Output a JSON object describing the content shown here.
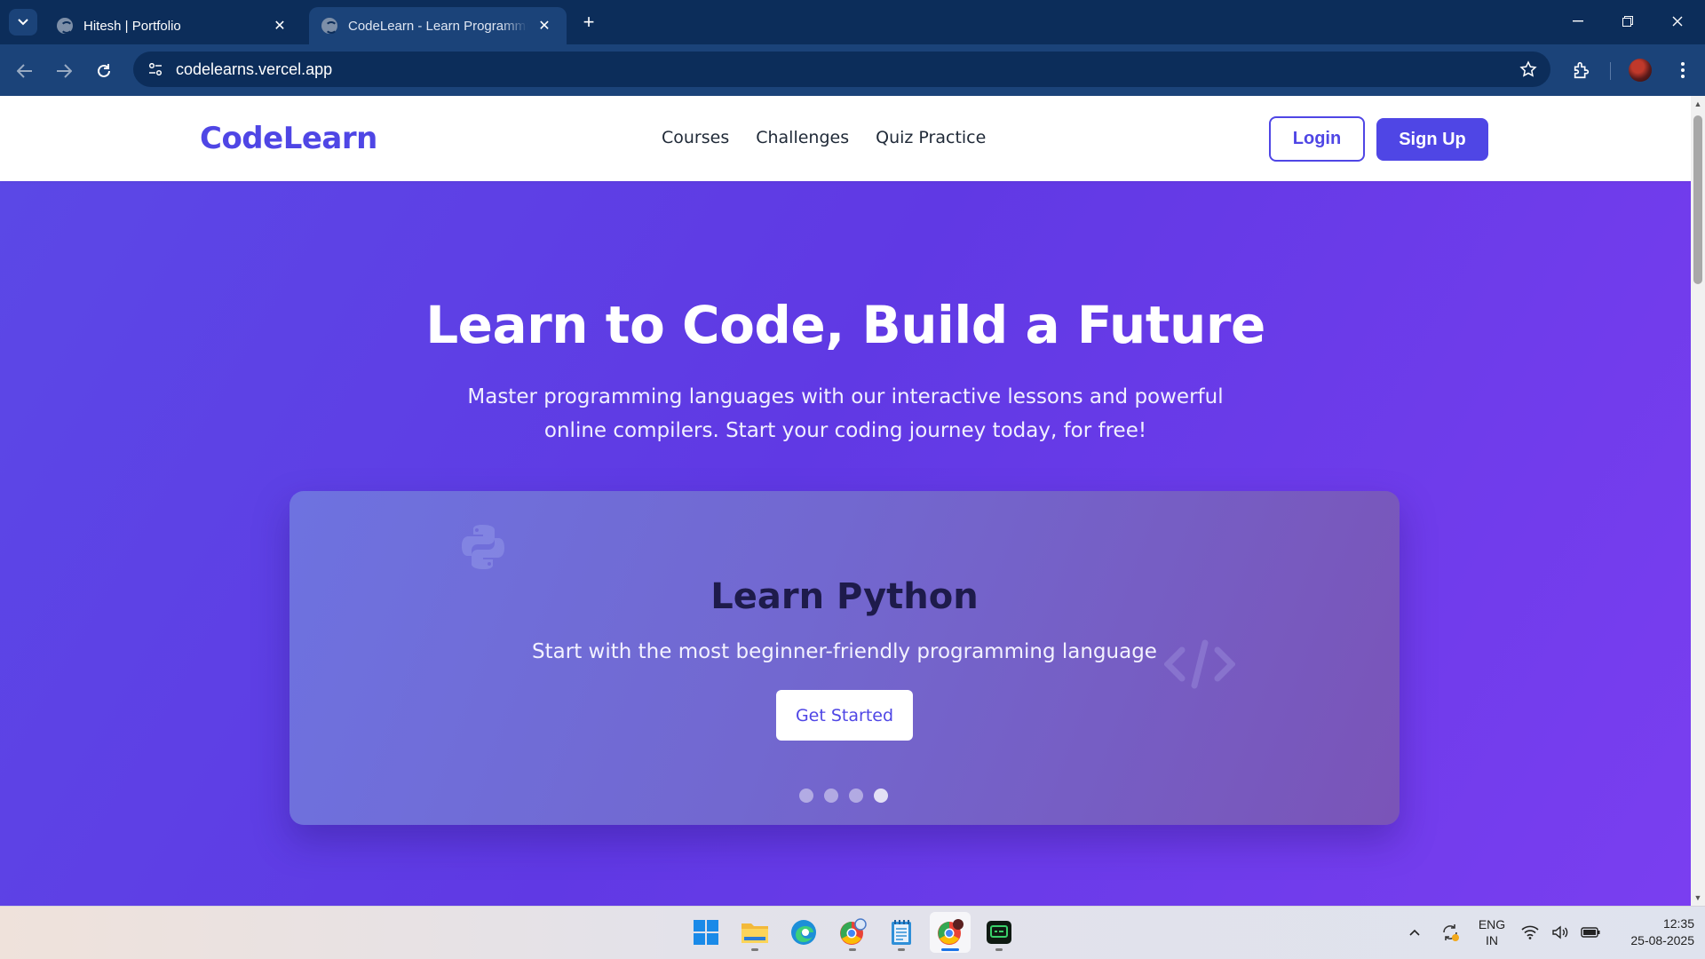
{
  "browser": {
    "tabs": [
      {
        "title": "Hitesh | Portfolio",
        "close": "✕"
      },
      {
        "title": "CodeLearn - Learn Programming",
        "close": "✕",
        "active": true
      }
    ],
    "new_tab": "+",
    "url": "codelearns.vercel.app"
  },
  "site": {
    "logo": "CodeLearn",
    "nav": [
      "Courses",
      "Challenges",
      "Quiz Practice"
    ],
    "login_label": "Login",
    "signup_label": "Sign Up",
    "brand_color": "#4f46e5"
  },
  "hero": {
    "title": "Learn to Code, Build a Future",
    "subtitle": "Master programming languages with our interactive lessons and powerful online compilers. Start your coding journey today, for free!"
  },
  "carousel": {
    "title": "Learn Python",
    "subtitle": "Start with the most beginner-friendly programming language",
    "cta": "Get Started",
    "slide_count": 4,
    "active_slide": 4,
    "icons": [
      "python-icon",
      "code-icon"
    ]
  },
  "taskbar": {
    "apps": [
      "windows-start-icon",
      "file-explorer-icon",
      "edge-icon",
      "chrome-profile-icon",
      "notepad-icon",
      "chrome-icon",
      "terminal-icon"
    ],
    "active_app": "chrome-icon",
    "language": {
      "line1": "ENG",
      "line2": "IN"
    },
    "time": "12:35",
    "date": "25-08-2025"
  }
}
